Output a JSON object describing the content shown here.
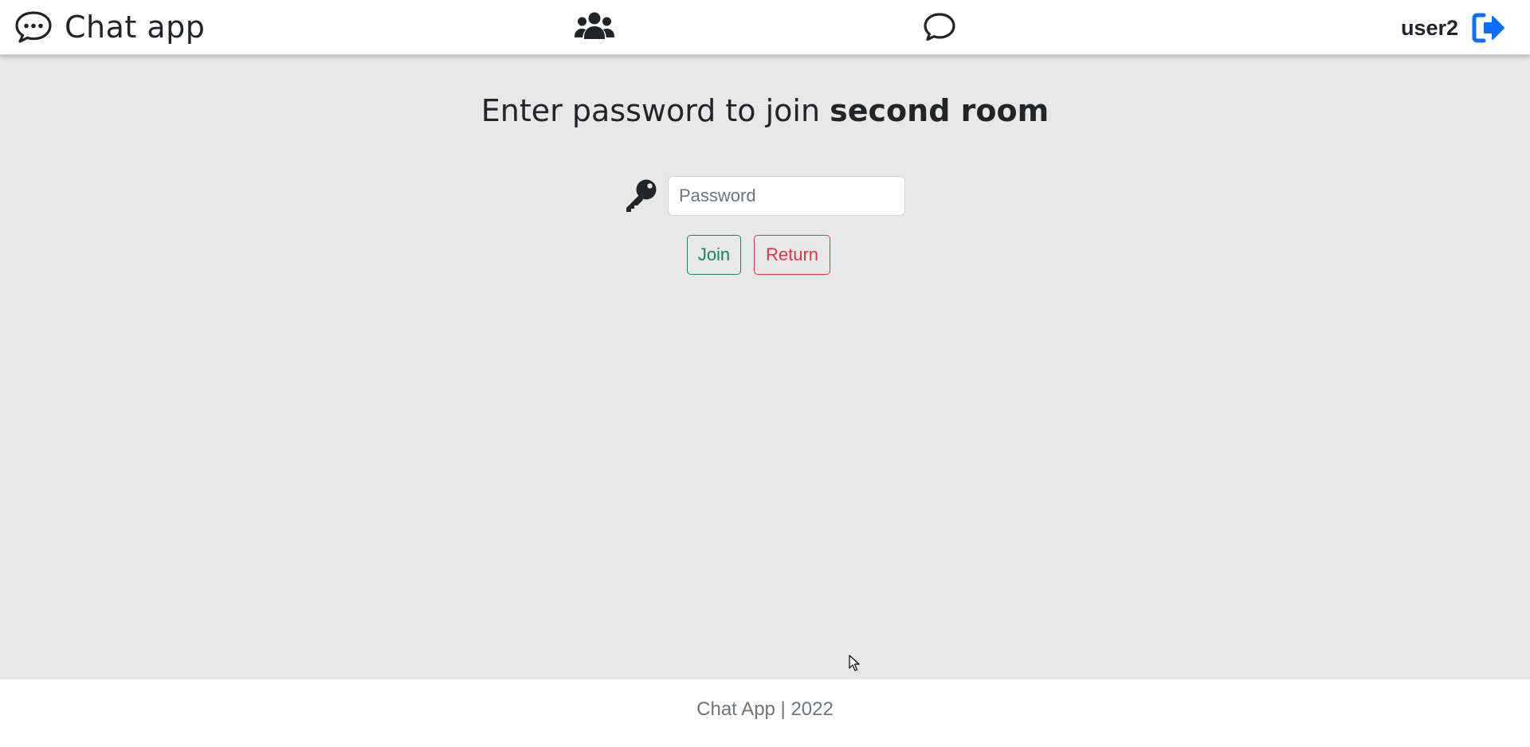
{
  "navbar": {
    "brand_text": "Chat app",
    "brand_icon": "chat-bubble-dots-icon",
    "users_icon": "users-icon",
    "chat_icon": "chat-icon",
    "username": "user2",
    "logout_icon": "logout-icon"
  },
  "main": {
    "heading_prefix": "Enter password to join ",
    "room_name": "second room",
    "password_placeholder": "Password",
    "password_value": "",
    "key_icon": "key-icon",
    "join_label": "Join",
    "return_label": "Return"
  },
  "footer": {
    "text": "Chat App | 2022"
  },
  "colors": {
    "background": "#e8e8e8",
    "navbar": "#ffffff",
    "accent_blue": "#0d6efd",
    "success": "#198754",
    "danger": "#dc3545",
    "muted": "#6c757d"
  }
}
